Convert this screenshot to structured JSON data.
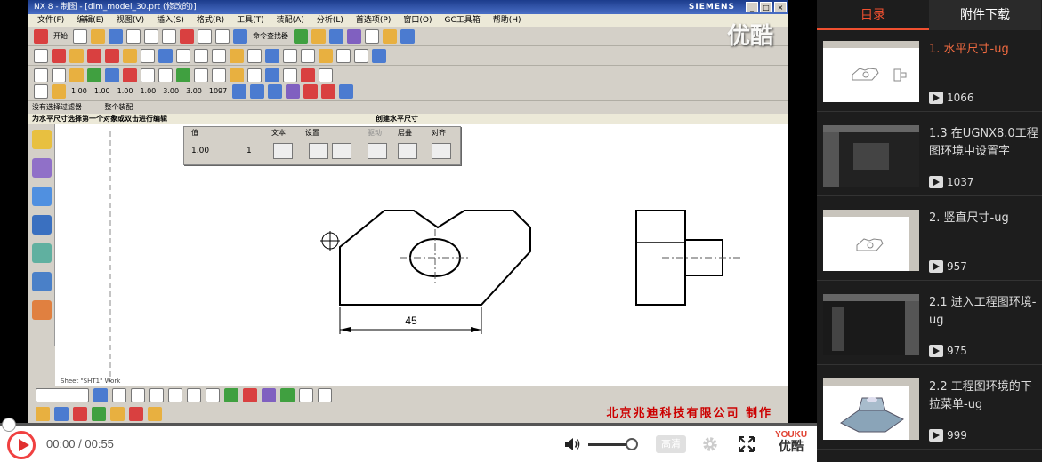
{
  "app": {
    "title": "NX 8 - 制图 - [dim_model_30.prt (修改的)]",
    "brand": "SIEMENS"
  },
  "menu": [
    "文件(F)",
    "编辑(E)",
    "视图(V)",
    "插入(S)",
    "格式(R)",
    "工具(T)",
    "装配(A)",
    "分析(L)",
    "首选项(P)",
    "窗口(O)",
    "GC工具箱",
    "帮助(H)"
  ],
  "toolbar": {
    "start_label": "开始",
    "command_finder_label": "命令查找器",
    "dim_values": [
      "1.00",
      "1.00",
      "1.00",
      "1.00",
      "3.00",
      "3.00",
      "1097"
    ]
  },
  "selection_bar": {
    "filter_label": "没有选择过滤器",
    "scope_label": "整个装配"
  },
  "status": {
    "prompt": "为水平尺寸选择第一个对象或双击进行编辑",
    "mode": "创建水平尺寸"
  },
  "dimension_dialog": {
    "value_header": "值",
    "text_header": "文本",
    "settings_header": "设置",
    "reference_header": "驱动",
    "layer_header": "层叠",
    "align_header": "对齐",
    "value": "1.00",
    "tolerance": "1"
  },
  "drawing": {
    "dimension_text": "45",
    "sheet_label": "Sheet \"SHT1\" Work"
  },
  "watermark": "北京兆迪科技有限公司  制作",
  "overlay_logo": "优酷",
  "player": {
    "time_current": "00:00",
    "time_total": "00:55",
    "time_display": "00:00 / 00:55",
    "quality_label": "高清",
    "logo_en": "YOUKU",
    "logo_cn": "优酷",
    "progress": 0.0,
    "volume": 0.85
  },
  "sidebar": {
    "tabs": [
      "目录",
      "附件下载"
    ],
    "items": [
      {
        "title": "1. 水平尺寸-ug",
        "views": "1066",
        "active": true
      },
      {
        "title": "1.3 在UGNX8.0工程图环境中设置字",
        "views": "1037",
        "active": false
      },
      {
        "title": "2. 竖直尺寸-ug",
        "views": "957",
        "active": false
      },
      {
        "title": "2.1 进入工程图环境-ug",
        "views": "975",
        "active": false
      },
      {
        "title": "2.2 工程图环境的下拉菜单-ug",
        "views": "999",
        "active": false
      }
    ]
  }
}
